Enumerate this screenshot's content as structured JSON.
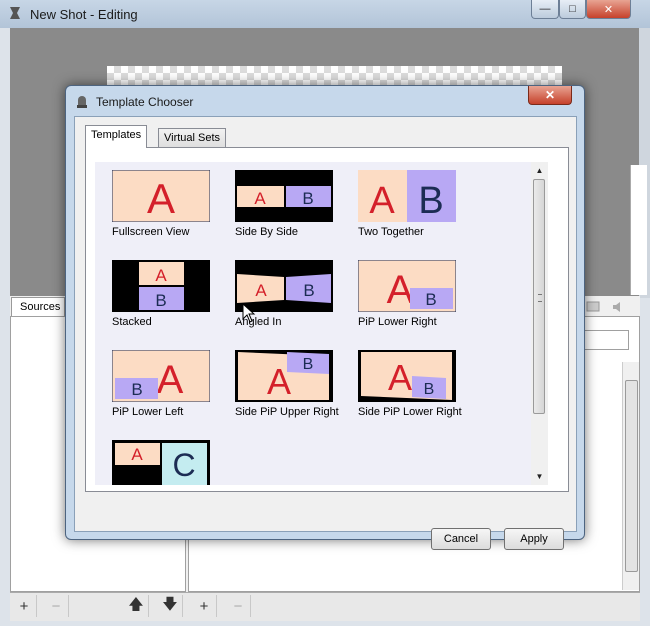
{
  "main_window": {
    "title": "New Shot - Editing",
    "controls": {
      "minimize": "—",
      "maximize": "□",
      "close": "✕"
    },
    "sources_tab": "Sources",
    "bottom_toolbar": {
      "add": "+",
      "remove": "−",
      "up": "🡅",
      "down": "🡇",
      "add2": "+",
      "remove2": "−"
    }
  },
  "dialog": {
    "title": "Template Chooser",
    "close": "✕",
    "tabs": [
      {
        "label": "Templates",
        "selected": true
      },
      {
        "label": "Virtual Sets",
        "selected": false
      }
    ],
    "templates": [
      {
        "label": "Fullscreen View",
        "layout": "fullscreen"
      },
      {
        "label": "Side By Side",
        "layout": "side-by-side"
      },
      {
        "label": "Two Together",
        "layout": "two-together"
      },
      {
        "label": "Stacked",
        "layout": "stacked"
      },
      {
        "label": "Angled In",
        "layout": "angled-in"
      },
      {
        "label": "PiP Lower Right",
        "layout": "pip-lower-right"
      },
      {
        "label": "PiP Lower Left",
        "layout": "pip-lower-left"
      },
      {
        "label": "Side PiP Upper Right",
        "layout": "side-pip-upper-right"
      },
      {
        "label": "Side PiP Lower Right",
        "layout": "side-pip-lower-right"
      },
      {
        "label": "",
        "layout": "three-way"
      }
    ],
    "thumb_letters": {
      "a": "A",
      "b": "B",
      "c": "C"
    },
    "buttons": {
      "cancel": "Cancel",
      "apply": "Apply"
    },
    "colors": {
      "peach": "#fcdcc4",
      "lavender": "#b8a8f4",
      "red": "#d4202a",
      "navy": "#1c2c54",
      "cyan": "#c4ecf0"
    }
  }
}
